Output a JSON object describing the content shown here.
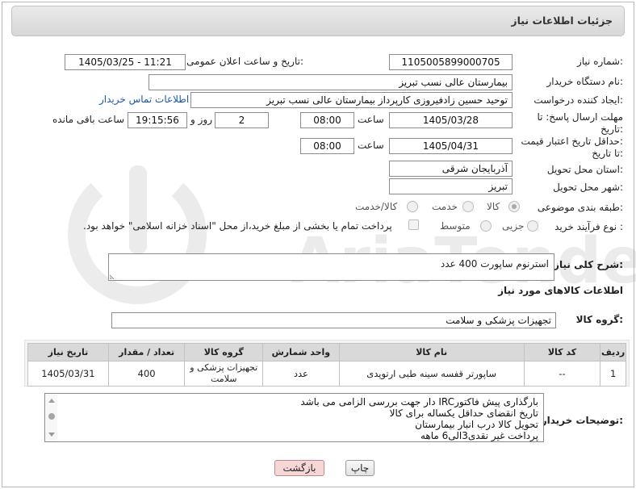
{
  "header": {
    "title": "جزئیات اطلاعات نیاز"
  },
  "form": {
    "need_number_label": "شماره نیاز:",
    "need_number": "1105005899000705",
    "announce_label": "تاریخ و ساعت اعلان عمومی:",
    "announce_value": "1405/03/25 - 11:21",
    "buyer_org_label": "نام دستگاه خریدار:",
    "buyer_org": "بیمارستان عالی نسب تبریز",
    "creator_label": "ایجاد کننده درخواست:",
    "creator": "توحید حسین زادفیروزی کارپرداز بیمارستان عالی نسب تبریز",
    "contact_link": "اطلاعات تماس خریدار",
    "deadline_label_1": "مهلت ارسال پاسخ: تا",
    "deadline_label_2": "تاریخ:",
    "deadline_date": "1405/03/28",
    "time_word": "ساعت",
    "deadline_time": "08:00",
    "days_count": "2",
    "days_word": "روز و",
    "remaining_time": "19:15:56",
    "remaining_word": "ساعت باقی مانده",
    "validity_label_1": "حداقل تاریخ اعتبار قیمت:",
    "validity_label_2": "تا تاریخ:",
    "validity_date": "1405/04/31",
    "validity_time": "08:00",
    "province_label": "استان محل تحویل:",
    "province": "آذربایجان شرقی",
    "city_label": "شهر محل تحویل:",
    "city": "تبریز",
    "category_label": "طبقه بندی موضوعی:",
    "category_options": [
      "کالا",
      "خدمت",
      "کالا/خدمت"
    ],
    "process_label": "نوع فرآیند خرید :",
    "process_options": [
      "جزیی",
      "متوسط"
    ],
    "payment_note": "پرداخت تمام یا بخشی از مبلغ خرید،از محل \"اسناد خزانه اسلامی\" خواهد بود.",
    "summary_label": "شرح کلی نیاز:",
    "summary": "استرنوم ساپورت 400 عدد",
    "items_section_title": "اطلاعات کالاهای مورد نیاز",
    "goods_group_label": "گروه کالا:",
    "goods_group": "تجهیزات پزشکی و سلامت",
    "buyer_notes_label": "توضیحات خریدار:"
  },
  "table": {
    "headers": [
      "ردیف",
      "کد کالا",
      "نام کالا",
      "واحد شمارش",
      "گروه کالا",
      "تعداد / مقدار",
      "تاریخ نیاز"
    ],
    "rows": [
      [
        "1",
        "--",
        "ساپورتر قفسه سینه طبی ارتوپدی",
        "عدد",
        "تجهیزات پزشکی و سلامت",
        "400",
        "1405/03/31"
      ]
    ]
  },
  "buyer_notes": [
    "بارگذاری پیش فاکتورIRC دار جهت بررسی الزامی می باشد",
    "تاریخ انقضای حداقل یکساله برای کالا",
    "تحویل کالا درب انبار بیمارستان",
    "پرداخت غیر نقدی3الی6 ماهه"
  ],
  "buttons": {
    "print": "چاپ",
    "back": "بازگشت"
  },
  "watermark_text": "AriaTender.net",
  "colors": {
    "link": "#1a55b8",
    "back_button": "#f7d6d6",
    "table_header": "#d9d9d9"
  }
}
